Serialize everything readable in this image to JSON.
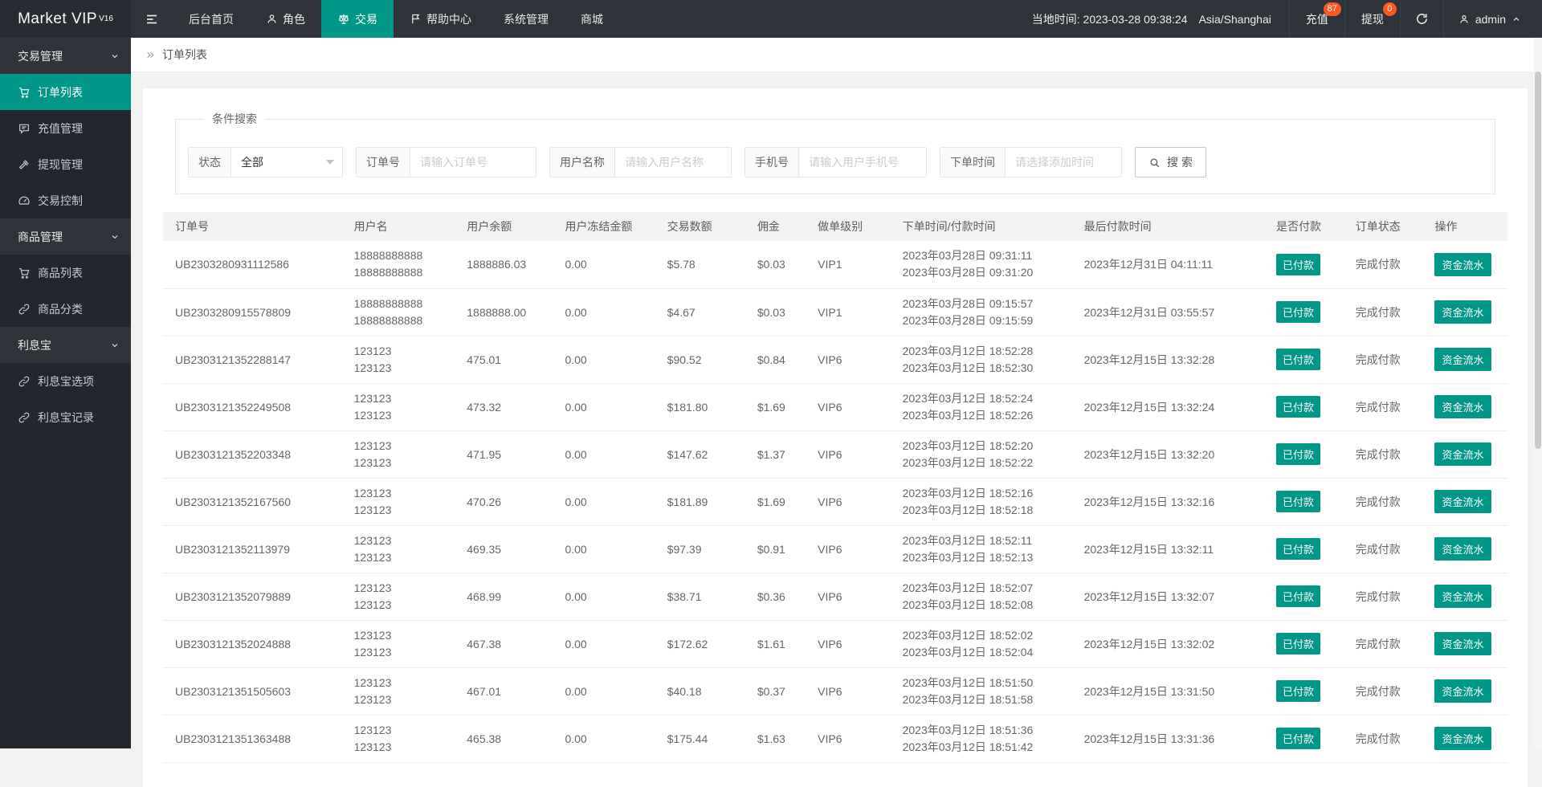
{
  "topbar": {
    "logo": "Market VIP",
    "logo_sup": "V16",
    "nav": [
      {
        "label": "后台首页",
        "icon": "none",
        "active": false
      },
      {
        "label": "角色",
        "icon": "user-icon",
        "active": false
      },
      {
        "label": "交易",
        "icon": "scales-icon",
        "active": true
      },
      {
        "label": "帮助中心",
        "icon": "flag-icon",
        "active": false
      },
      {
        "label": "系统管理",
        "icon": "none",
        "active": false
      },
      {
        "label": "商城",
        "icon": "none",
        "active": false
      }
    ],
    "local_time": "当地时间: 2023-03-28 09:38:24",
    "timezone": "Asia/Shanghai",
    "recharge_label": "充值",
    "recharge_badge": "87",
    "withdraw_label": "提现",
    "withdraw_badge": "0",
    "username": "admin",
    "accent_color": "#009688",
    "badge_color": "#ff5722"
  },
  "sidebar": {
    "items": [
      {
        "label": "交易管理",
        "type": "group"
      },
      {
        "label": "订单列表",
        "type": "item",
        "icon": "cart-icon",
        "active": true
      },
      {
        "label": "充值管理",
        "type": "item",
        "icon": "speech-bubble-icon",
        "active": false
      },
      {
        "label": "提现管理",
        "type": "item",
        "icon": "gavel-icon",
        "active": false
      },
      {
        "label": "交易控制",
        "type": "item",
        "icon": "gauge-icon",
        "active": false
      },
      {
        "label": "商品管理",
        "type": "group"
      },
      {
        "label": "商品列表",
        "type": "item",
        "icon": "cart-icon",
        "active": false
      },
      {
        "label": "商品分类",
        "type": "item",
        "icon": "link-icon",
        "active": false
      },
      {
        "label": "利息宝",
        "type": "group"
      },
      {
        "label": "利息宝选项",
        "type": "item",
        "icon": "link-icon",
        "active": false
      },
      {
        "label": "利息宝记录",
        "type": "item",
        "icon": "link-icon",
        "active": false
      }
    ]
  },
  "breadcrumb": "订单列表",
  "search": {
    "legend": "条件搜索",
    "status_label": "状态",
    "status_value": "全部",
    "order_label": "订单号",
    "order_placeholder": "请输入订单号",
    "username_label": "用户名称",
    "username_placeholder": "请输入用户名称",
    "phone_label": "手机号",
    "phone_placeholder": "请输入用户手机号",
    "time_label": "下单时间",
    "time_placeholder": "请选择添加时间",
    "search_button": "搜 索"
  },
  "table": {
    "headers": [
      "订单号",
      "用户名",
      "用户余额",
      "用户冻结金额",
      "交易数额",
      "佣金",
      "做单级别",
      "下单时间/付款时间",
      "最后付款时间",
      "是否付款",
      "订单状态",
      "操作"
    ],
    "rows": [
      {
        "order_no": "UB2303280931112586",
        "user_line1": "18888888888",
        "user_line2": "18888888888",
        "balance": "1888886.03",
        "frozen": "0.00",
        "amount": "$5.78",
        "commission": "$0.03",
        "level": "VIP1",
        "order_time": "2023年03月28日 09:31:11",
        "pay_time": "2023年03月28日 09:31:20",
        "last_pay_time": "2023年12月31日 04:11:11",
        "paid_label": "已付款",
        "status": "完成付款",
        "action_label": "资金流水"
      },
      {
        "order_no": "UB2303280915578809",
        "user_line1": "18888888888",
        "user_line2": "18888888888",
        "balance": "1888888.00",
        "frozen": "0.00",
        "amount": "$4.67",
        "commission": "$0.03",
        "level": "VIP1",
        "order_time": "2023年03月28日 09:15:57",
        "pay_time": "2023年03月28日 09:15:59",
        "last_pay_time": "2023年12月31日 03:55:57",
        "paid_label": "已付款",
        "status": "完成付款",
        "action_label": "资金流水"
      },
      {
        "order_no": "UB2303121352288147",
        "user_line1": "123123",
        "user_line2": "123123",
        "balance": "475.01",
        "frozen": "0.00",
        "amount": "$90.52",
        "commission": "$0.84",
        "level": "VIP6",
        "order_time": "2023年03月12日 18:52:28",
        "pay_time": "2023年03月12日 18:52:30",
        "last_pay_time": "2023年12月15日 13:32:28",
        "paid_label": "已付款",
        "status": "完成付款",
        "action_label": "资金流水"
      },
      {
        "order_no": "UB2303121352249508",
        "user_line1": "123123",
        "user_line2": "123123",
        "balance": "473.32",
        "frozen": "0.00",
        "amount": "$181.80",
        "commission": "$1.69",
        "level": "VIP6",
        "order_time": "2023年03月12日 18:52:24",
        "pay_time": "2023年03月12日 18:52:26",
        "last_pay_time": "2023年12月15日 13:32:24",
        "paid_label": "已付款",
        "status": "完成付款",
        "action_label": "资金流水"
      },
      {
        "order_no": "UB2303121352203348",
        "user_line1": "123123",
        "user_line2": "123123",
        "balance": "471.95",
        "frozen": "0.00",
        "amount": "$147.62",
        "commission": "$1.37",
        "level": "VIP6",
        "order_time": "2023年03月12日 18:52:20",
        "pay_time": "2023年03月12日 18:52:22",
        "last_pay_time": "2023年12月15日 13:32:20",
        "paid_label": "已付款",
        "status": "完成付款",
        "action_label": "资金流水"
      },
      {
        "order_no": "UB2303121352167560",
        "user_line1": "123123",
        "user_line2": "123123",
        "balance": "470.26",
        "frozen": "0.00",
        "amount": "$181.89",
        "commission": "$1.69",
        "level": "VIP6",
        "order_time": "2023年03月12日 18:52:16",
        "pay_time": "2023年03月12日 18:52:18",
        "last_pay_time": "2023年12月15日 13:32:16",
        "paid_label": "已付款",
        "status": "完成付款",
        "action_label": "资金流水"
      },
      {
        "order_no": "UB2303121352113979",
        "user_line1": "123123",
        "user_line2": "123123",
        "balance": "469.35",
        "frozen": "0.00",
        "amount": "$97.39",
        "commission": "$0.91",
        "level": "VIP6",
        "order_time": "2023年03月12日 18:52:11",
        "pay_time": "2023年03月12日 18:52:13",
        "last_pay_time": "2023年12月15日 13:32:11",
        "paid_label": "已付款",
        "status": "完成付款",
        "action_label": "资金流水"
      },
      {
        "order_no": "UB2303121352079889",
        "user_line1": "123123",
        "user_line2": "123123",
        "balance": "468.99",
        "frozen": "0.00",
        "amount": "$38.71",
        "commission": "$0.36",
        "level": "VIP6",
        "order_time": "2023年03月12日 18:52:07",
        "pay_time": "2023年03月12日 18:52:08",
        "last_pay_time": "2023年12月15日 13:32:07",
        "paid_label": "已付款",
        "status": "完成付款",
        "action_label": "资金流水"
      },
      {
        "order_no": "UB2303121352024888",
        "user_line1": "123123",
        "user_line2": "123123",
        "balance": "467.38",
        "frozen": "0.00",
        "amount": "$172.62",
        "commission": "$1.61",
        "level": "VIP6",
        "order_time": "2023年03月12日 18:52:02",
        "pay_time": "2023年03月12日 18:52:04",
        "last_pay_time": "2023年12月15日 13:32:02",
        "paid_label": "已付款",
        "status": "完成付款",
        "action_label": "资金流水"
      },
      {
        "order_no": "UB2303121351505603",
        "user_line1": "123123",
        "user_line2": "123123",
        "balance": "467.01",
        "frozen": "0.00",
        "amount": "$40.18",
        "commission": "$0.37",
        "level": "VIP6",
        "order_time": "2023年03月12日 18:51:50",
        "pay_time": "2023年03月12日 18:51:58",
        "last_pay_time": "2023年12月15日 13:31:50",
        "paid_label": "已付款",
        "status": "完成付款",
        "action_label": "资金流水"
      },
      {
        "order_no": "UB2303121351363488",
        "user_line1": "123123",
        "user_line2": "123123",
        "balance": "465.38",
        "frozen": "0.00",
        "amount": "$175.44",
        "commission": "$1.63",
        "level": "VIP6",
        "order_time": "2023年03月12日 18:51:36",
        "pay_time": "2023年03月12日 18:51:42",
        "last_pay_time": "2023年12月15日 13:31:36",
        "paid_label": "已付款",
        "status": "完成付款",
        "action_label": "资金流水"
      }
    ]
  }
}
